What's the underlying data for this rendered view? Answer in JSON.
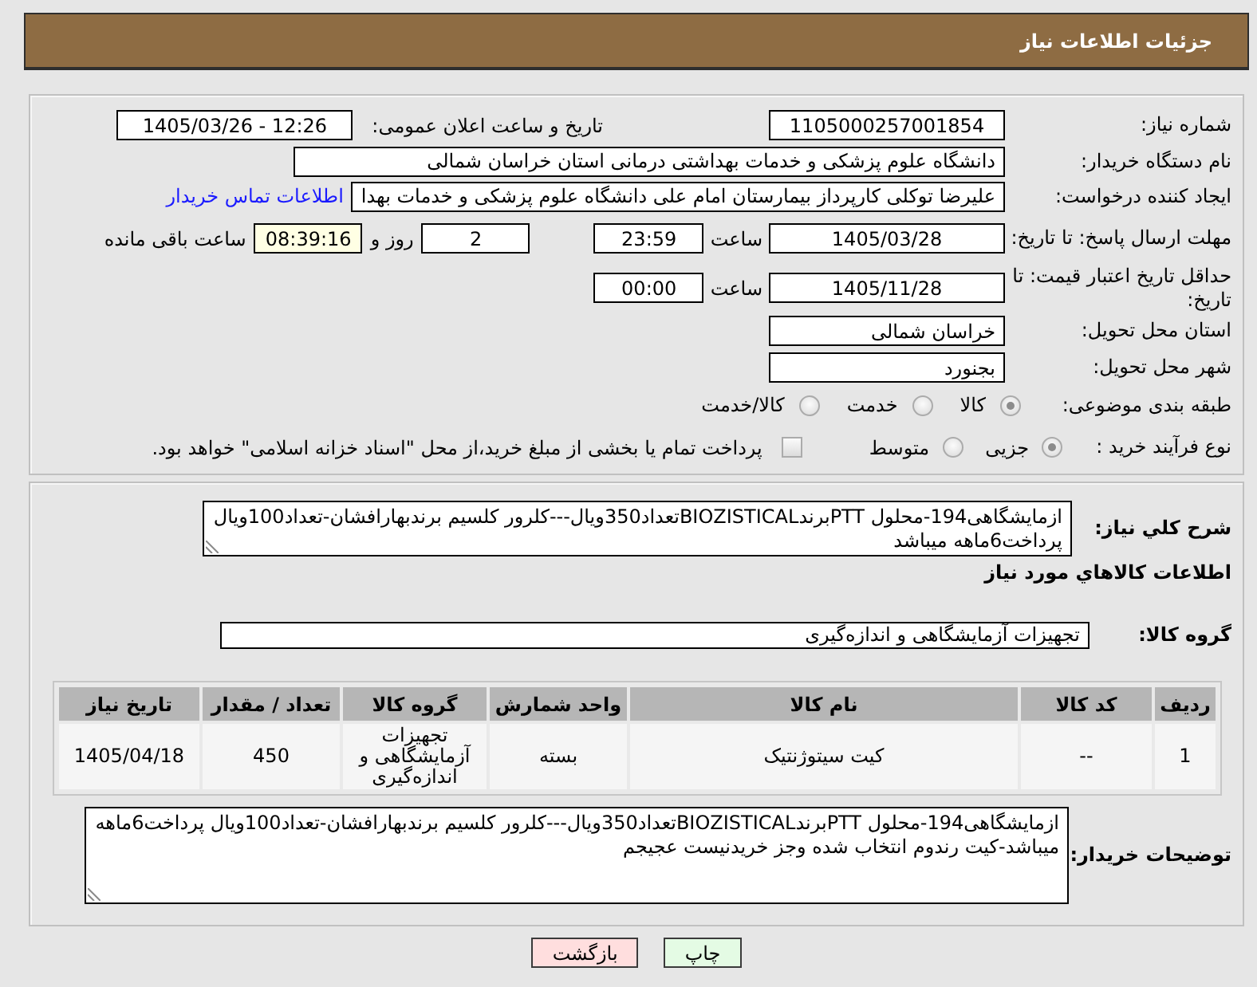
{
  "header": {
    "title": "جزئیات اطلاعات نیاز"
  },
  "details": {
    "need_number": {
      "label": "شماره نیاز:",
      "value": "1105000257001854"
    },
    "announcement": {
      "label": "تاریخ و ساعت اعلان عمومی:",
      "value": "1405/03/26 - 12:26"
    },
    "buyer_organization": {
      "label": "نام دستگاه خریدار:",
      "value": "دانشگاه علوم پزشکی و خدمات بهداشتی درمانی استان خراسان شمالی"
    },
    "requester": {
      "label": "ایجاد کننده درخواست:",
      "value": "علیرضا توکلی کارپرداز بیمارستان امام علی دانشگاه علوم پزشکی و خدمات بهدا",
      "contact_link": "اطلاعات تماس خریدار"
    },
    "response_deadline": {
      "label": "مهلت ارسال پاسخ: تا تاریخ:",
      "date": "1405/03/28",
      "time_label": "ساعت",
      "time": "23:59",
      "days": "2",
      "days_label": "روز و",
      "remaining": "08:39:16",
      "remaining_label": "ساعت باقی مانده"
    },
    "price_validity": {
      "label": "حداقل تاریخ اعتبار قیمت: تا تاریخ:",
      "date": "1405/11/28",
      "time_label": "ساعت",
      "time": "00:00"
    },
    "delivery_province": {
      "label": "استان محل تحویل:",
      "value": "خراسان شمالی"
    },
    "delivery_city": {
      "label": "شهر محل تحویل:",
      "value": "بجنورد"
    },
    "subject_category": {
      "label": "طبقه بندی موضوعی:",
      "options": [
        {
          "label": "کالا",
          "selected": true
        },
        {
          "label": "خدمت",
          "selected": false
        },
        {
          "label": "کالا/خدمت",
          "selected": false
        }
      ]
    },
    "purchase_process": {
      "label": "نوع فرآیند خرید :",
      "options": [
        {
          "label": "جزیی",
          "selected": true
        },
        {
          "label": "متوسط",
          "selected": false
        }
      ],
      "treasury_payment": {
        "label": "پرداخت تمام یا بخشی از مبلغ خرید،از محل \"اسناد خزانه اسلامی\" خواهد بود.",
        "checked": false
      }
    }
  },
  "needs": {
    "description": {
      "label": "شرح کلي نياز:",
      "value": "ازمایشگاهی194-محلول PTTبرندBIOZISTICALتعداد350ویال---کلرور کلسیم برندبهارافشان-تعداد100ویال پرداخت6ماهه میباشد"
    },
    "goods_heading": "اطلاعات کالاهاي مورد نياز",
    "goods_group": {
      "label": "گروه کالا:",
      "value": "تجهیزات آزمایشگاهی و اندازه‌گیری"
    },
    "table": {
      "columns": [
        "ردیف",
        "کد کالا",
        "نام کالا",
        "واحد شمارش",
        "گروه کالا",
        "تعداد / مقدار",
        "تاریخ نیاز"
      ],
      "rows": [
        [
          "1",
          "--",
          "کیت سیتوژنتیک",
          "بسته",
          "تجهیزات آزمایشگاهی و اندازه‌گیری",
          "450",
          "1405/04/18"
        ]
      ]
    },
    "buyer_notes": {
      "label": "توضیحات خریدار:",
      "value": "ازمایشگاهی194-محلول PTTبرندBIOZISTICALتعداد350ویال---کلرور کلسیم برندبهارافشان-تعداد100ویال پرداخت6ماهه میباشد-کیت رندوم انتخاب شده وجز خریدنیست عجیجم"
    }
  },
  "buttons": [
    {
      "kind": "print",
      "label": "چاپ"
    },
    {
      "kind": "back",
      "label": "بازگشت"
    }
  ]
}
